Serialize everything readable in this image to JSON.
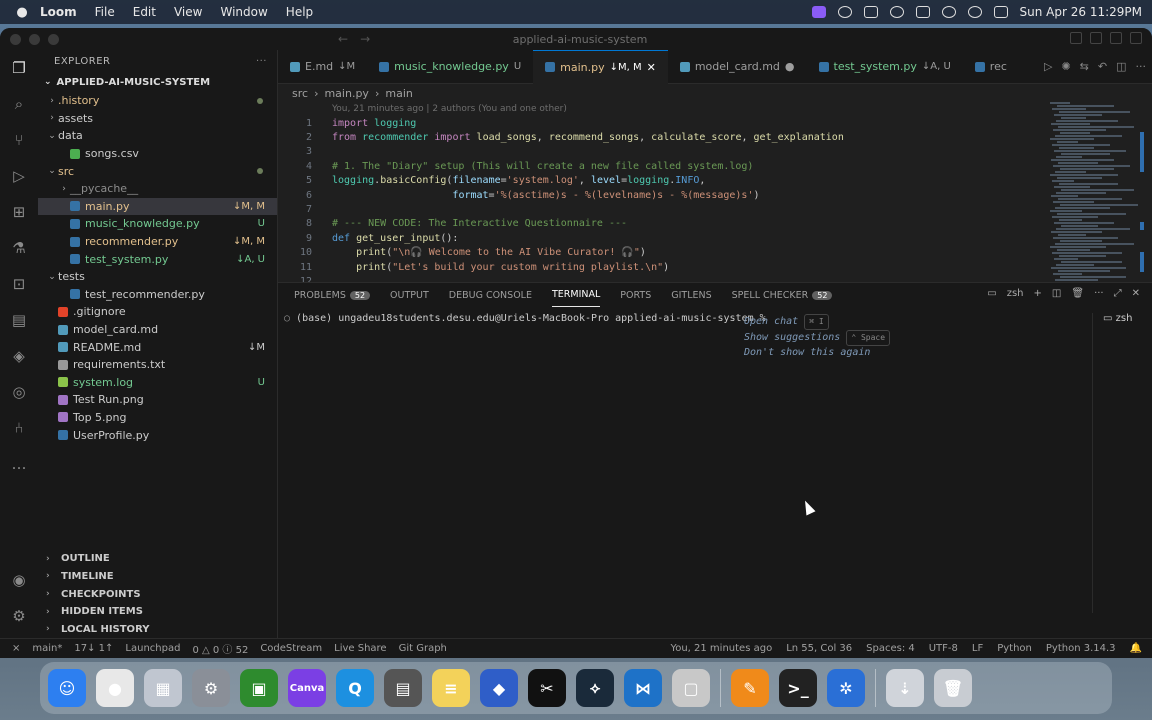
{
  "menubar": {
    "app": "Loom",
    "items": [
      "File",
      "Edit",
      "View",
      "Window",
      "Help"
    ],
    "clock": "Sun Apr 26  11:29PM"
  },
  "window": {
    "title": "applied-ai-music-system"
  },
  "explorer": {
    "header": "EXPLORER",
    "project": "APPLIED-AI-MUSIC-SYSTEM",
    "tree": [
      {
        "label": ".history",
        "status": "",
        "kind": "folder",
        "indent": 1,
        "expanded": false,
        "color": "mod"
      },
      {
        "label": "assets",
        "status": "",
        "kind": "folder",
        "indent": 1,
        "expanded": false,
        "color": ""
      },
      {
        "label": "data",
        "status": "",
        "kind": "folder",
        "indent": 1,
        "expanded": true,
        "color": ""
      },
      {
        "label": "songs.csv",
        "status": "",
        "kind": "csv",
        "indent": 2,
        "color": ""
      },
      {
        "label": "src",
        "status": "",
        "kind": "folder",
        "indent": 1,
        "expanded": true,
        "color": "mod"
      },
      {
        "label": "__pycache__",
        "status": "",
        "kind": "folder",
        "indent": 2,
        "expanded": false,
        "color": "ign"
      },
      {
        "label": "main.py",
        "status": "↓M, M",
        "kind": "py",
        "indent": 2,
        "color": "mod",
        "selected": true
      },
      {
        "label": "music_knowledge.py",
        "status": "U",
        "kind": "py",
        "indent": 2,
        "color": "add"
      },
      {
        "label": "recommender.py",
        "status": "↓M, M",
        "kind": "py",
        "indent": 2,
        "color": "mod"
      },
      {
        "label": "test_system.py",
        "status": "↓A, U",
        "kind": "py",
        "indent": 2,
        "color": "add"
      },
      {
        "label": "tests",
        "status": "",
        "kind": "folder",
        "indent": 1,
        "expanded": true,
        "color": ""
      },
      {
        "label": "test_recommender.py",
        "status": "",
        "kind": "py",
        "indent": 2,
        "color": ""
      },
      {
        "label": ".gitignore",
        "status": "",
        "kind": "git",
        "indent": 1,
        "color": ""
      },
      {
        "label": "model_card.md",
        "status": "",
        "kind": "md",
        "indent": 1,
        "color": ""
      },
      {
        "label": "README.md",
        "status": "↓M",
        "kind": "md",
        "indent": 1,
        "color": ""
      },
      {
        "label": "requirements.txt",
        "status": "",
        "kind": "txt",
        "indent": 1,
        "color": ""
      },
      {
        "label": "system.log",
        "status": "U",
        "kind": "log",
        "indent": 1,
        "color": "add"
      },
      {
        "label": "Test Run.png",
        "status": "",
        "kind": "img",
        "indent": 1,
        "color": ""
      },
      {
        "label": "Top 5.png",
        "status": "",
        "kind": "img",
        "indent": 1,
        "color": ""
      },
      {
        "label": "UserProfile.py",
        "status": "",
        "kind": "py",
        "indent": 1,
        "color": ""
      }
    ],
    "sections": [
      "OUTLINE",
      "TIMELINE",
      "CHECKPOINTS",
      "HIDDEN ITEMS",
      "LOCAL HISTORY"
    ]
  },
  "tabs": [
    {
      "label": "E.md",
      "status": "↓M",
      "active": false
    },
    {
      "label": "music_knowledge.py",
      "status": "U",
      "active": false
    },
    {
      "label": "main.py",
      "status": "↓M, M",
      "active": true
    },
    {
      "label": "model_card.md",
      "status": "",
      "active": false
    },
    {
      "label": "test_system.py",
      "status": "↓A, U",
      "active": false
    },
    {
      "label": "rec",
      "status": "",
      "active": false
    }
  ],
  "breadcrumb": [
    "src",
    "main.py",
    "main"
  ],
  "blame": "You, 21 minutes ago | 2 authors (You and one other)",
  "code_lines": [
    {
      "n": "1",
      "html": "<span class=\"k\">import</span> <span class=\"n\">logging</span>"
    },
    {
      "n": "2",
      "html": "<span class=\"k\">from</span> <span class=\"n\">recommender</span> <span class=\"k\">import</span> <span class=\"f\">load_songs</span>, <span class=\"f\">recommend_songs</span>, <span class=\"f\">calculate_score</span>, <span class=\"f\">get_explanation</span>"
    },
    {
      "n": "3",
      "html": ""
    },
    {
      "n": "4",
      "html": "<span class=\"cm\"># 1. The \"Diary\" setup (This will create a new file called system.log)</span>"
    },
    {
      "n": "5",
      "html": "<span class=\"n\">logging</span>.<span class=\"f\">basicConfig</span>(<span class=\"v\">filename</span>=<span class=\"s\">'system.log'</span>, <span class=\"v\">level</span>=<span class=\"n\">logging</span>.<span class=\"b\">INFO</span>,"
    },
    {
      "n": "6",
      "html": "                    <span class=\"v\">format</span>=<span class=\"s\">'%(asctime)s - %(levelname)s - %(message)s'</span>)"
    },
    {
      "n": "7",
      "html": ""
    },
    {
      "n": "8",
      "html": "<span class=\"cm\"># --- NEW CODE: The Interactive Questionnaire ---</span>"
    },
    {
      "n": "9",
      "html": "<span class=\"b\">def</span> <span class=\"f\">get_user_input</span>():"
    },
    {
      "n": "10",
      "html": "    <span class=\"f\">print</span>(<span class=\"s\">\"\\n🎧 Welcome to the AI Vibe Curator! 🎧\"</span>)"
    },
    {
      "n": "11",
      "html": "    <span class=\"f\">print</span>(<span class=\"s\">\"Let's build your custom writing playlist.\\n\"</span>)"
    },
    {
      "n": "12",
      "html": ""
    }
  ],
  "panel": {
    "tabs": [
      {
        "label": "PROBLEMS",
        "badge": "52"
      },
      {
        "label": "OUTPUT",
        "badge": ""
      },
      {
        "label": "DEBUG CONSOLE",
        "badge": ""
      },
      {
        "label": "TERMINAL",
        "badge": "",
        "active": true
      },
      {
        "label": "PORTS",
        "badge": ""
      },
      {
        "label": "GITLENS",
        "badge": ""
      },
      {
        "label": "SPELL CHECKER",
        "badge": "52"
      }
    ],
    "shell": "zsh",
    "prompt": "(base) ungadeu18students.desu.edu@Uriels-MacBook-Pro applied-ai-music-system %",
    "hints": [
      "Open chat",
      "Show suggestions",
      "Don't show this again"
    ],
    "hint_keys": [
      "⌘ I",
      "⌃ Space"
    ]
  },
  "statusbar": {
    "branch": "main*",
    "sync": "17↓ 1↑",
    "launchpad": "Launchpad",
    "problems": "0 △ 0 ⓘ 52",
    "codestream": "CodeStream",
    "liveshare": "Live Share",
    "gitgraph": "Git Graph",
    "blame": "You, 21 minutes ago",
    "position": "Ln 55, Col 36",
    "spaces": "Spaces: 4",
    "encoding": "UTF-8",
    "eol": "LF",
    "language": "Python",
    "interpreter": "Python 3.14.3"
  },
  "dock": [
    {
      "name": "finder",
      "color": "#2d7ff0",
      "glyph": "☺"
    },
    {
      "name": "chrome",
      "color": "#e8e8e8",
      "glyph": "●"
    },
    {
      "name": "launchpad",
      "color": "#c0c6d0",
      "glyph": "▦"
    },
    {
      "name": "system-settings",
      "color": "#8a8f98",
      "glyph": "⚙"
    },
    {
      "name": "minecraft",
      "color": "#2e8b2e",
      "glyph": "▣"
    },
    {
      "name": "canva",
      "color": "#7b3fe4",
      "glyph": "Canva"
    },
    {
      "name": "quicktime",
      "color": "#1d90e0",
      "glyph": "Q"
    },
    {
      "name": "calculator",
      "color": "#555",
      "glyph": "▤"
    },
    {
      "name": "notes",
      "color": "#f3d25a",
      "glyph": "≡"
    },
    {
      "name": "simulator",
      "color": "#2f5ec8",
      "glyph": "◆"
    },
    {
      "name": "capcut",
      "color": "#111",
      "glyph": "✂"
    },
    {
      "name": "pycharm",
      "color": "#1a2a3a",
      "glyph": "⟡"
    },
    {
      "name": "vscode",
      "color": "#1e72c8",
      "glyph": "⋈"
    },
    {
      "name": "preview",
      "color": "#c8c8c8",
      "glyph": "▢"
    },
    {
      "name": "pencil-app",
      "color": "#f08a1a",
      "glyph": "✎"
    },
    {
      "name": "terminal",
      "color": "#222",
      "glyph": ">_"
    },
    {
      "name": "settings-gear-app",
      "color": "#2a6fd6",
      "glyph": "✲"
    },
    {
      "name": "downloads",
      "color": "#d0d4da",
      "glyph": "⇣"
    },
    {
      "name": "trash",
      "color": "#c8ccd2",
      "glyph": "🗑"
    }
  ]
}
